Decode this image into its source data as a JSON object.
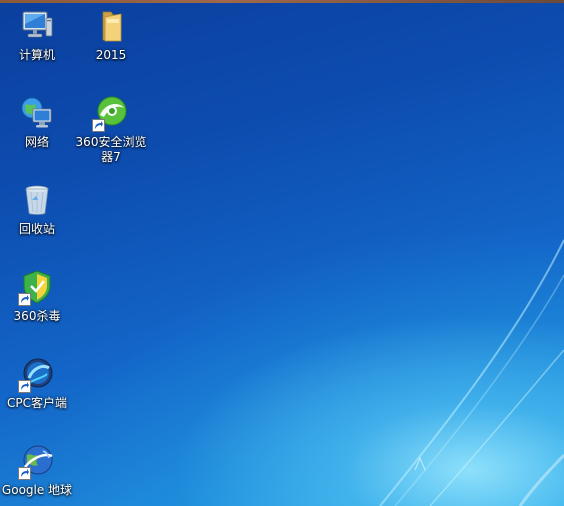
{
  "desktop": {
    "icons": [
      {
        "label": "计算机",
        "icon": "computer-icon"
      },
      {
        "label": "2015",
        "icon": "folder-icon"
      },
      {
        "label": "网络",
        "icon": "network-icon"
      },
      {
        "label": "360安全浏览器7",
        "icon": "360-browser-icon"
      },
      {
        "label": "回收站",
        "icon": "recycle-bin-icon"
      },
      {
        "label": "360杀毒",
        "icon": "360-antivirus-icon"
      },
      {
        "label": "CPC客户端",
        "icon": "cpc-client-icon"
      },
      {
        "label": "Google 地球",
        "icon": "google-earth-icon"
      }
    ]
  },
  "colors": {
    "wallpaper_top": "#0b3f9e",
    "wallpaper_bottom": "#2aa0e0",
    "label_text": "#ffffff"
  }
}
